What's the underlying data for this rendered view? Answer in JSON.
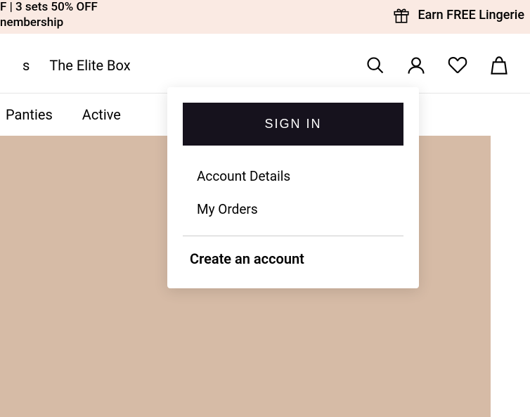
{
  "promo": {
    "left_line1": "F | 3 sets 50% OFF",
    "left_line2": "nembership",
    "right": "Earn FREE Lingerie"
  },
  "header": {
    "partial": "s",
    "elite_box": "The Elite Box"
  },
  "nav": {
    "item1": "Panties",
    "item2": "Active"
  },
  "dropdown": {
    "signin": "SIGN IN",
    "account_details": "Account Details",
    "my_orders": "My Orders",
    "create_account": "Create an account"
  }
}
